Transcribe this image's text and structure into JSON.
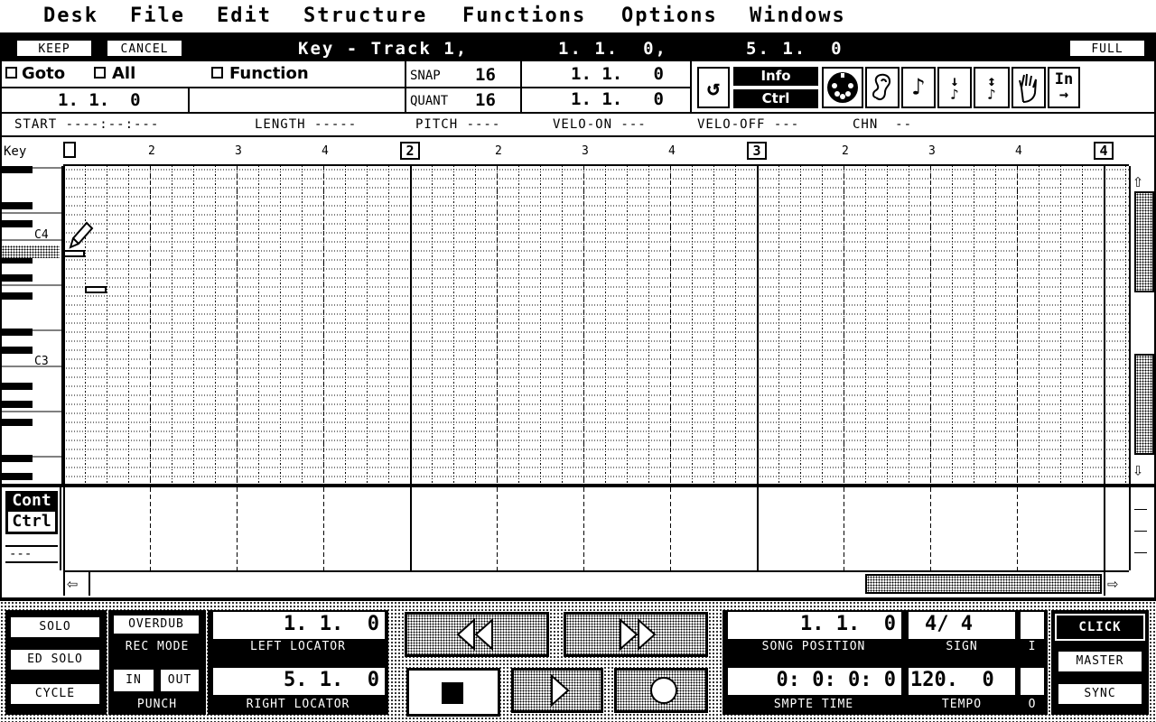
{
  "menubar": {
    "items": [
      "Desk",
      "File",
      "Edit",
      "Structure",
      "Functions",
      "Options",
      "Windows"
    ]
  },
  "window": {
    "keep_label": "KEEP",
    "cancel_label": "CANCEL",
    "title": "Key - Track 1,",
    "title_start": "1. 1.  0,",
    "title_end": "5. 1.  0",
    "full_label": "FULL"
  },
  "editor": {
    "goto_label": "Goto",
    "all_label": "All",
    "function_label": "Function",
    "position": "1. 1.  0",
    "snap_label": "SNAP",
    "snap_value": "16",
    "quant_label": "QUANT",
    "quant_value": "16",
    "pos1": "1. 1.   0",
    "pos2": "1. 1.   0",
    "info_label": "Info",
    "ctrl_label": "Ctrl",
    "in_label": "In",
    "icons": [
      "loop-icon",
      "midi-icon",
      "ear-icon",
      "eighth-note-icon",
      "note-down-icon",
      "note-up-icon",
      "hand-icon",
      "input-arrow-icon"
    ]
  },
  "event_header": {
    "start": "START ----:--:---",
    "length": "LENGTH -----",
    "pitch": "PITCH ----",
    "velo_on": "VELO-ON ---",
    "velo_off": "VELO-OFF ---",
    "chn": "CHN  --"
  },
  "ruler": {
    "key_label": "Key",
    "beats": [
      "2",
      "3",
      "4",
      "2",
      "3",
      "4",
      "2",
      "3",
      "4"
    ],
    "bars": [
      "2",
      "3",
      "4"
    ],
    "c4_label": "C4",
    "c3_label": "C3"
  },
  "controller": {
    "label1": "Cont",
    "label2": "Ctrl",
    "dash": "---"
  },
  "transport": {
    "solo": "SOLO",
    "ed_solo": "ED SOLO",
    "cycle": "CYCLE",
    "overdub": "OVERDUB",
    "rec_mode": "REC MODE",
    "in": "IN",
    "out": "OUT",
    "punch": "PUNCH",
    "left_locator_value": "1. 1.  0",
    "left_locator_label": "LEFT LOCATOR",
    "right_locator_value": "5. 1.  0",
    "right_locator_label": "RIGHT LOCATOR",
    "song_position_value": "1. 1.  0",
    "song_position_label": "SONG POSITION",
    "sign_value": "4/ 4",
    "sign_label": "SIGN",
    "smpte_value": "0: 0: 0: 0",
    "smpte_label": "SMPTE TIME",
    "tempo_value": "120.  0",
    "tempo_label": "TEMPO",
    "i_label": "I",
    "o_label": "O",
    "click": "CLICK",
    "master": "MASTER",
    "sync": "SYNC"
  }
}
